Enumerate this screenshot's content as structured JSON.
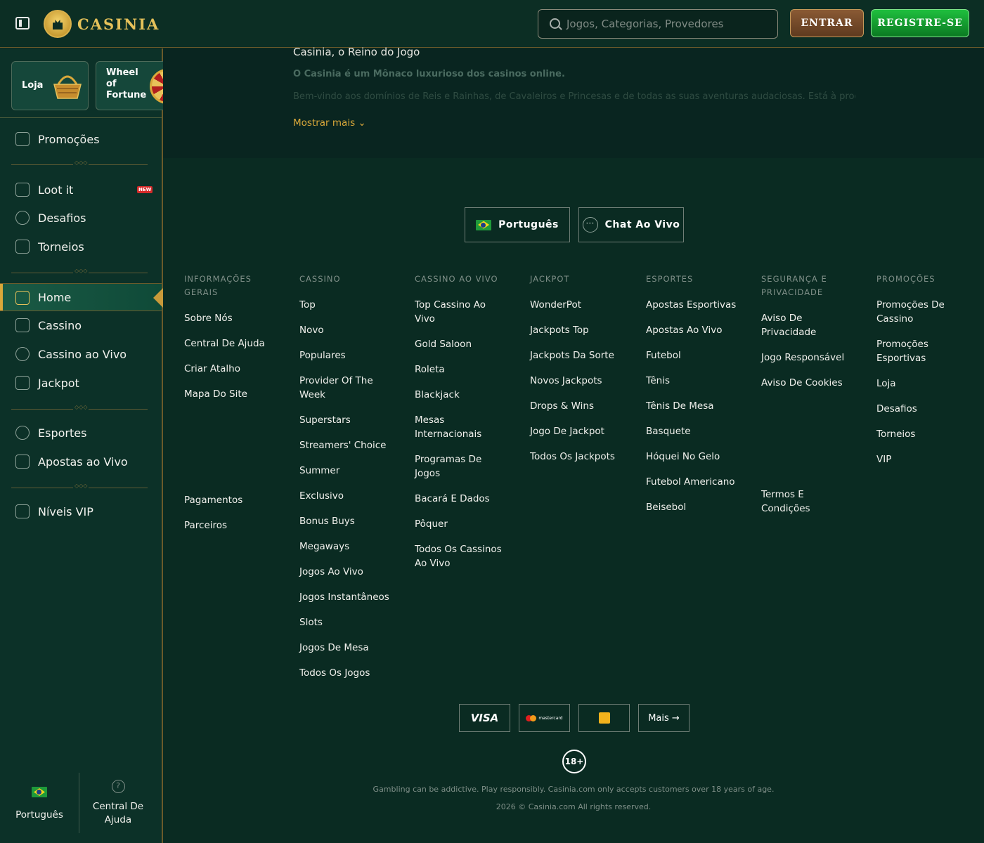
{
  "header": {
    "logo_text": "CASINIA",
    "search_placeholder": "Jogos, Categorias, Provedores",
    "enter_label": "ENTRAR",
    "register_label": "REGISTRE-SE"
  },
  "sidebar": {
    "promo_cards": [
      {
        "label": "Loja"
      },
      {
        "label": "Wheel of Fortune"
      }
    ],
    "items": [
      {
        "label": "Promoções",
        "icon": "treasure-chest-icon"
      },
      {
        "label": "Loot it",
        "icon": "gift-box-icon",
        "badge": "NEW"
      },
      {
        "label": "Desafios",
        "icon": "helmet-icon"
      },
      {
        "label": "Torneios",
        "icon": "trophy-icon"
      },
      {
        "label": "Home",
        "icon": "castle-icon",
        "active": true
      },
      {
        "label": "Cassino",
        "icon": "slot-machine-icon"
      },
      {
        "label": "Cassino ao Vivo",
        "icon": "chip-icon"
      },
      {
        "label": "Jackpot",
        "icon": "seven-icon"
      },
      {
        "label": "Esportes",
        "icon": "soccer-ball-icon"
      },
      {
        "label": "Apostas ao Vivo",
        "icon": "live-bet-icon"
      },
      {
        "label": "Níveis VIP",
        "icon": "crown-icon"
      }
    ],
    "footer": {
      "language_label": "Português",
      "help_label_1": "Central De",
      "help_label_2": "Ajuda"
    }
  },
  "main": {
    "seo_title": "Casinia, o Reino do Jogo",
    "seo_subtitle": "O Casinia é um Mônaco luxurioso dos casinos online.",
    "seo_faded": "Bem-vindo aos domínios de Reis e Rainhas, de Cavaleiros e Princesas e de todas as suas aventuras audaciosas. Está à procura",
    "show_more": "Mostrar mais",
    "language_button": "Português",
    "chat_button": "Chat Ao Vivo",
    "columns": [
      {
        "head": [
          "INFORMAÇÕES",
          "GERAIS"
        ],
        "links": [
          [
            "Sobre Nós"
          ],
          [
            "Central De Ajuda"
          ],
          [
            "Criar Atalho"
          ],
          [
            "Mapa Do Site"
          ]
        ],
        "extra_links": [
          [
            "Pagamentos"
          ],
          [
            "Parceiros"
          ]
        ]
      },
      {
        "head": [
          "CASSINO"
        ],
        "links": [
          [
            "Top"
          ],
          [
            "Novo"
          ],
          [
            "Populares"
          ],
          [
            "Provider Of The",
            "Week"
          ],
          [
            "Superstars"
          ],
          [
            "Streamers' Choice"
          ],
          [
            "Summer"
          ],
          [
            "Exclusivo"
          ],
          [
            "Bonus Buys"
          ],
          [
            "Megaways"
          ],
          [
            "Jogos Ao Vivo"
          ],
          [
            "Jogos Instantâneos"
          ],
          [
            "Slots"
          ],
          [
            "Jogos De Mesa"
          ],
          [
            "Todos Os Jogos"
          ]
        ]
      },
      {
        "head": [
          "CASSINO AO VIVO"
        ],
        "links": [
          [
            "Top Cassino Ao",
            "Vivo"
          ],
          [
            "Gold Saloon"
          ],
          [
            "Roleta"
          ],
          [
            "Blackjack"
          ],
          [
            "Mesas",
            "Internacionais"
          ],
          [
            "Programas De",
            "Jogos"
          ],
          [
            "Bacará E Dados"
          ],
          [
            "Pôquer"
          ],
          [
            "Todos Os Cassinos",
            "Ao Vivo"
          ]
        ]
      },
      {
        "head": [
          "JACKPOT"
        ],
        "links": [
          [
            "WonderPot"
          ],
          [
            "Jackpots Top"
          ],
          [
            "Jackpots Da Sorte"
          ],
          [
            "Novos Jackpots"
          ],
          [
            "Drops & Wins"
          ],
          [
            "Jogo De Jackpot"
          ],
          [
            "Todos Os Jackpots"
          ]
        ]
      },
      {
        "head": [
          "ESPORTES"
        ],
        "links": [
          [
            "Apostas Esportivas"
          ],
          [
            "Apostas Ao Vivo"
          ],
          [
            "Futebol"
          ],
          [
            "Tênis"
          ],
          [
            "Tênis De Mesa"
          ],
          [
            "Basquete"
          ],
          [
            "Hóquei No Gelo"
          ],
          [
            "Futebol Americano"
          ],
          [
            "Beisebol"
          ]
        ]
      },
      {
        "head": [
          "SEGURANÇA E",
          "PRIVACIDADE"
        ],
        "links": [
          [
            "Aviso De",
            "Privacidade"
          ],
          [
            "Jogo Responsável"
          ],
          [
            "Aviso De Cookies"
          ]
        ],
        "extra_links": [
          [
            "Termos E",
            "Condições"
          ]
        ]
      },
      {
        "head": [
          "PROMOÇÕES"
        ],
        "links": [
          [
            "Promoções De",
            "Cassino"
          ],
          [
            "Promoções",
            "Esportivas"
          ],
          [
            "Loja"
          ],
          [
            "Desafios"
          ],
          [
            "Torneios"
          ],
          [
            "VIP"
          ]
        ]
      }
    ],
    "payments": {
      "visa": "VISA",
      "mastercard": "mastercard",
      "more": "Mais →"
    },
    "age_badge": "18+",
    "disclaimer": "Gambling can be addictive. Play responsibly. Casinia.com only accepts customers over 18 years of age.",
    "copyright": "2026 © Casinia.com All rights reserved."
  }
}
